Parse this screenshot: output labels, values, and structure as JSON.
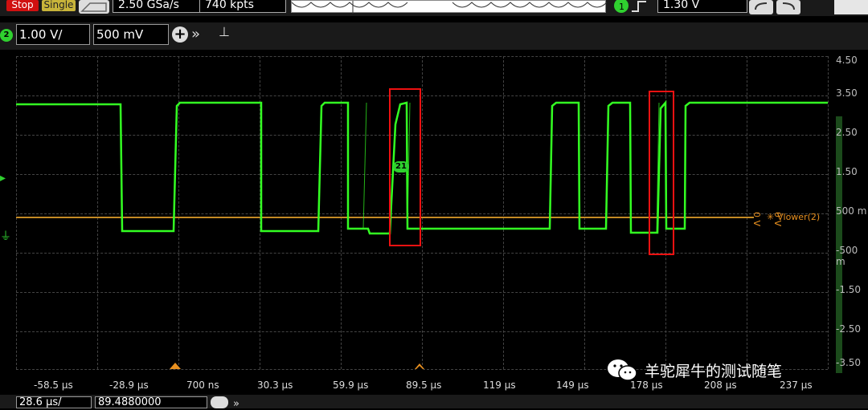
{
  "toolbar": {
    "stop_label": "Stop",
    "single_label": "Single",
    "sample_rate": "2.50 GSa/s",
    "memory_depth": "740 kpts",
    "trigger_level": "1.30 V"
  },
  "channel2": {
    "badge": "2",
    "scale": "1.00 V/",
    "offset": "500 mV"
  },
  "y_axis_labels": [
    "4.50",
    "3.50",
    "2.50",
    "1.50",
    "500 m",
    "-500 m",
    "-1.50",
    "-2.50",
    "-3.50"
  ],
  "x_axis_labels": [
    "-58.5 µs",
    "-28.9 µs",
    "700 ns",
    "30.3 µs",
    "59.9 µs",
    "89.5 µs",
    "119 µs",
    "149 µs",
    "178 µs",
    "208 µs",
    "237 µs"
  ],
  "cursor": {
    "label": "Vlower(2)",
    "marker_a": "0 V",
    "marker_b": "0 V"
  },
  "waveform_tag": "21",
  "watermark_text": "羊驼犀牛的测试随笔",
  "footer": {
    "field1": "28.6 µs/",
    "field2": "89.4880000"
  },
  "colors": {
    "trace": "#33ff22",
    "reference": "#c48a24",
    "highlight_box": "#ee1111",
    "stop_button": "#d01010"
  }
}
